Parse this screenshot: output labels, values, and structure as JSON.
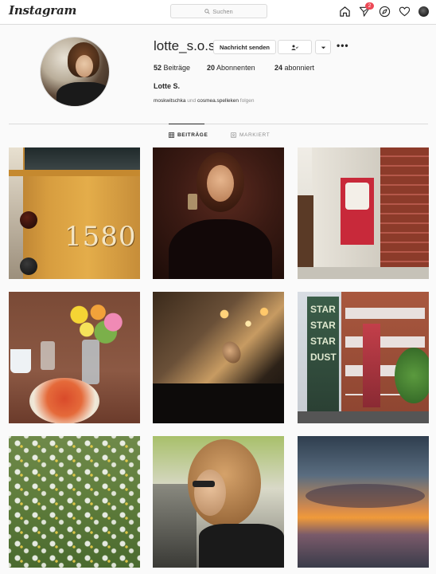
{
  "topbar": {
    "logo": "Instagram",
    "search_placeholder": "Suchen",
    "notification_count": "2"
  },
  "profile": {
    "username": "lotte_s.o.s",
    "message_button": "Nachricht senden",
    "stats": {
      "posts_count": "52",
      "posts_label": "Beiträge",
      "followers_count": "20",
      "followers_label": "Abonnenten",
      "following_count": "24",
      "following_label": "abonniert"
    },
    "full_name": "Lotte S.",
    "followed_by": {
      "account1": "moskwitschka",
      "and": "und",
      "account2": "cosmea.spelleken",
      "suffix": "folgen"
    }
  },
  "tabs": [
    {
      "label": "BEITRÄGE",
      "active": true
    },
    {
      "label": "MARKIERT",
      "active": false
    }
  ],
  "posts": {
    "tram_number": "1580",
    "mural_text": "STAR STAR STAR DUST"
  },
  "colors": {
    "accent_badge": "#ed4956",
    "border": "#dbdbdb",
    "muted_text": "#8e8e8e"
  }
}
